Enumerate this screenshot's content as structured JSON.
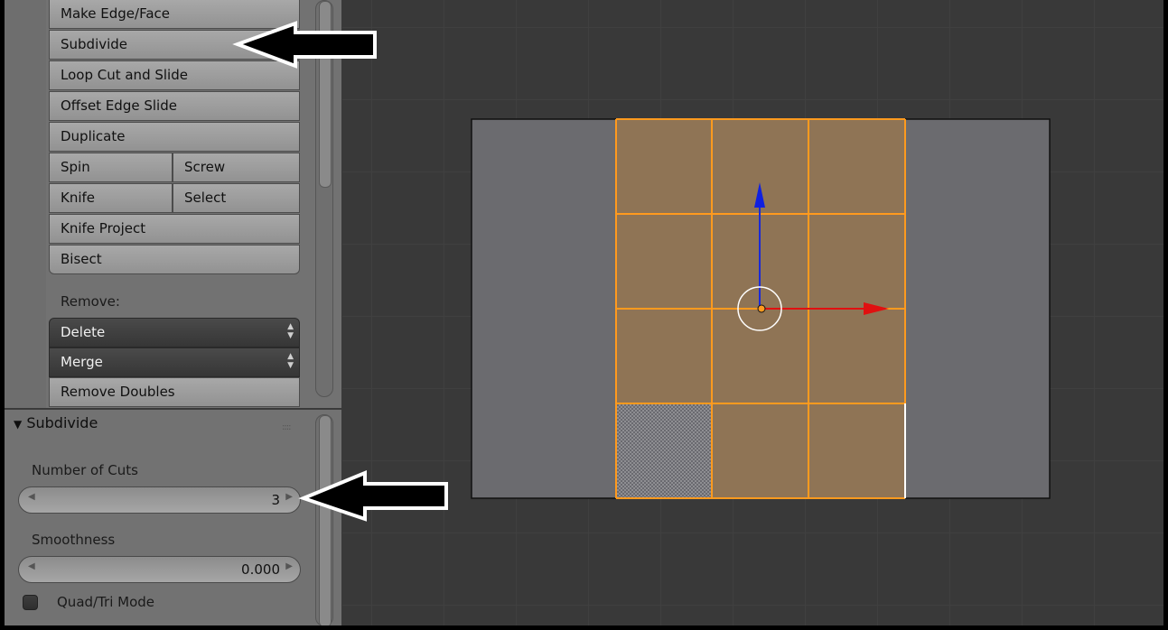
{
  "tools": {
    "make_edge_face": "Make Edge/Face",
    "subdivide": "Subdivide",
    "loop_cut_slide": "Loop Cut and Slide",
    "offset_edge_slide": "Offset Edge Slide",
    "duplicate": "Duplicate",
    "spin": "Spin",
    "screw": "Screw",
    "knife": "Knife",
    "select": "Select",
    "knife_project": "Knife Project",
    "bisect": "Bisect",
    "remove_label": "Remove:",
    "delete": "Delete",
    "merge": "Merge",
    "remove_doubles": "Remove Doubles"
  },
  "operator_panel": {
    "title": "Subdivide",
    "collapse_glyph": "▼",
    "grip_glyph": "::::",
    "number_of_cuts_label": "Number of Cuts",
    "number_of_cuts_value": "3",
    "smoothness_label": "Smoothness",
    "smoothness_value": "0.000",
    "quad_tri_label": "Quad/Tri Mode",
    "quad_tri_checked": false
  },
  "icons": {
    "dropdown_arrows": "▲▼",
    "left_arrow": "◀",
    "right_arrow": "▶"
  },
  "viewport": {
    "mesh_grid": "3x4 faces",
    "selected_color": "#ff9a1e",
    "face_color": "#8f7455",
    "plane_color": "#6b6b6f",
    "axis_x_color": "#e01010",
    "axis_z_color": "#1020e0"
  }
}
